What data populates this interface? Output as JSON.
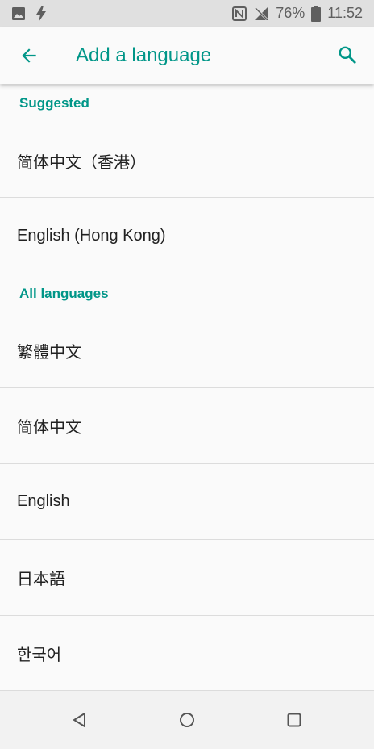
{
  "status_bar": {
    "battery": "76%",
    "time": "11:52"
  },
  "app_bar": {
    "title": "Add a language"
  },
  "sections": {
    "suggested": "Suggested",
    "all_languages": "All languages"
  },
  "suggested_items": [
    {
      "label": "简体中文（香港）"
    },
    {
      "label": "English (Hong Kong)"
    }
  ],
  "all_items": [
    {
      "label": "繁體中文"
    },
    {
      "label": "简体中文"
    },
    {
      "label": "English"
    },
    {
      "label": "日本語"
    },
    {
      "label": "한국어"
    }
  ],
  "colors": {
    "accent": "#009688",
    "status_bar_bg": "#e0e0e0",
    "background": "#fafafa"
  },
  "icons": [
    "image-icon",
    "flash-icon",
    "nfc-icon",
    "no-signal-icon",
    "battery-icon",
    "back-arrow-icon",
    "search-icon",
    "back-triangle-icon",
    "home-circle-icon",
    "recents-square-icon"
  ]
}
